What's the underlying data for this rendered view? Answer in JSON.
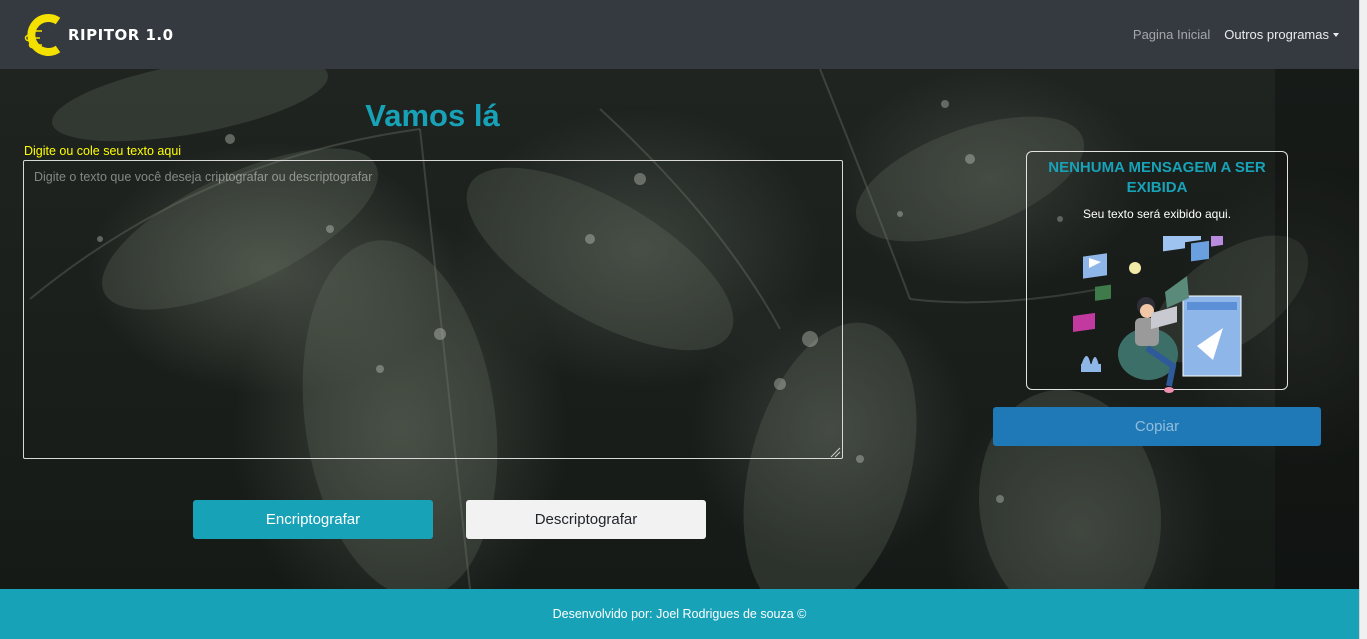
{
  "brand": {
    "name": "RIPITOR 1.0",
    "logo_letter": "C"
  },
  "nav": {
    "home_label": "Pagina Inicial",
    "programs_label": "Outros programas"
  },
  "main": {
    "heading": "Vamos lá",
    "input_label": "Digite ou cole seu texto aqui",
    "input_placeholder": "Digite o texto que você deseja criptografar ou descriptografar",
    "input_value": "",
    "encrypt_label": "Encriptografar",
    "decrypt_label": "Descriptografar"
  },
  "output": {
    "title": "NENHUMA MENSAGEM A SER EXIBIDA",
    "subtitle": "Seu texto será exibido aqui.",
    "copy_label": "Copiar"
  },
  "footer": {
    "text": "Desenvolvido por: Joel Rodrigues de souza ©"
  },
  "colors": {
    "accent": "#17a2b8",
    "navbar": "#343a40",
    "copy_button": "#1f79b7",
    "label_yellow": "#ffff00",
    "logo_yellow": "#f5e100"
  },
  "icons": [
    "logo-c-icon",
    "caret-down-icon",
    "person-laptop-illustration",
    "resize-grip-icon"
  ]
}
